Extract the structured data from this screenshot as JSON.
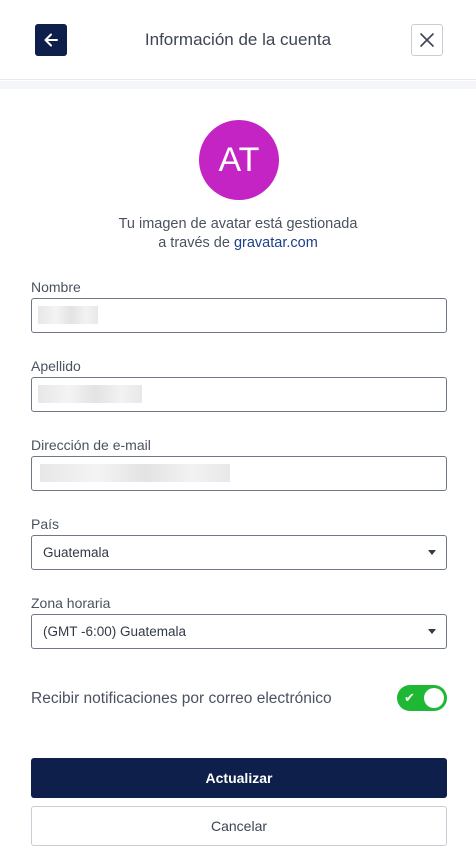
{
  "header": {
    "title": "Información de la cuenta",
    "back_icon": "arrow-left-icon",
    "close_icon": "close-icon"
  },
  "avatar": {
    "initials": "AT",
    "color": "#c524c4",
    "note_line1": "Tu imagen de avatar está gestionada",
    "note_prefix": "a través de ",
    "note_link": "gravatar.com"
  },
  "form": {
    "nombre": {
      "label": "Nombre",
      "value": ""
    },
    "apellido": {
      "label": "Apellido",
      "value": ""
    },
    "email": {
      "label": "Dirección de e-mail",
      "value": ""
    },
    "pais": {
      "label": "País",
      "selected": "Guatemala"
    },
    "zona": {
      "label": "Zona horaria",
      "selected": "(GMT -6:00) Guatemala"
    },
    "notifications": {
      "label": "Recibir notificaciones por correo electrónico",
      "enabled": true
    }
  },
  "actions": {
    "update_label": "Actualizar",
    "cancel_label": "Cancelar"
  },
  "colors": {
    "primary": "#0f1f4b",
    "toggle_on": "#1fb834",
    "link": "#1b3f8a"
  }
}
